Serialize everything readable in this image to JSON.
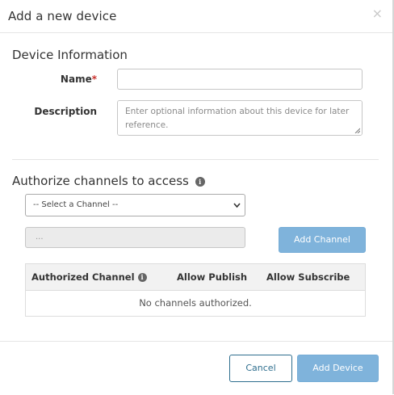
{
  "modal": {
    "title": "Add a new device",
    "close_glyph": "×"
  },
  "device_info": {
    "heading": "Device Information",
    "name_label": "Name",
    "name_required_marker": "*",
    "name_value": "",
    "description_label": "Description",
    "description_placeholder": "Enter optional information about this device for later reference."
  },
  "channels": {
    "heading": "Authorize channels to access",
    "heading_icon": "info-icon",
    "select_selected": "-- Select a Channel --",
    "channel_input_value": "...",
    "add_channel_label": "Add Channel",
    "table": {
      "headers": [
        "Authorized Channel",
        "Allow Publish",
        "Allow Subscribe"
      ],
      "empty_message": "No channels authorized."
    }
  },
  "footer": {
    "cancel_label": "Cancel",
    "add_device_label": "Add Device"
  },
  "colors": {
    "primary_disabled": "#7fb3db",
    "cancel_border": "#2e6e8e",
    "required": "#c9302c"
  }
}
